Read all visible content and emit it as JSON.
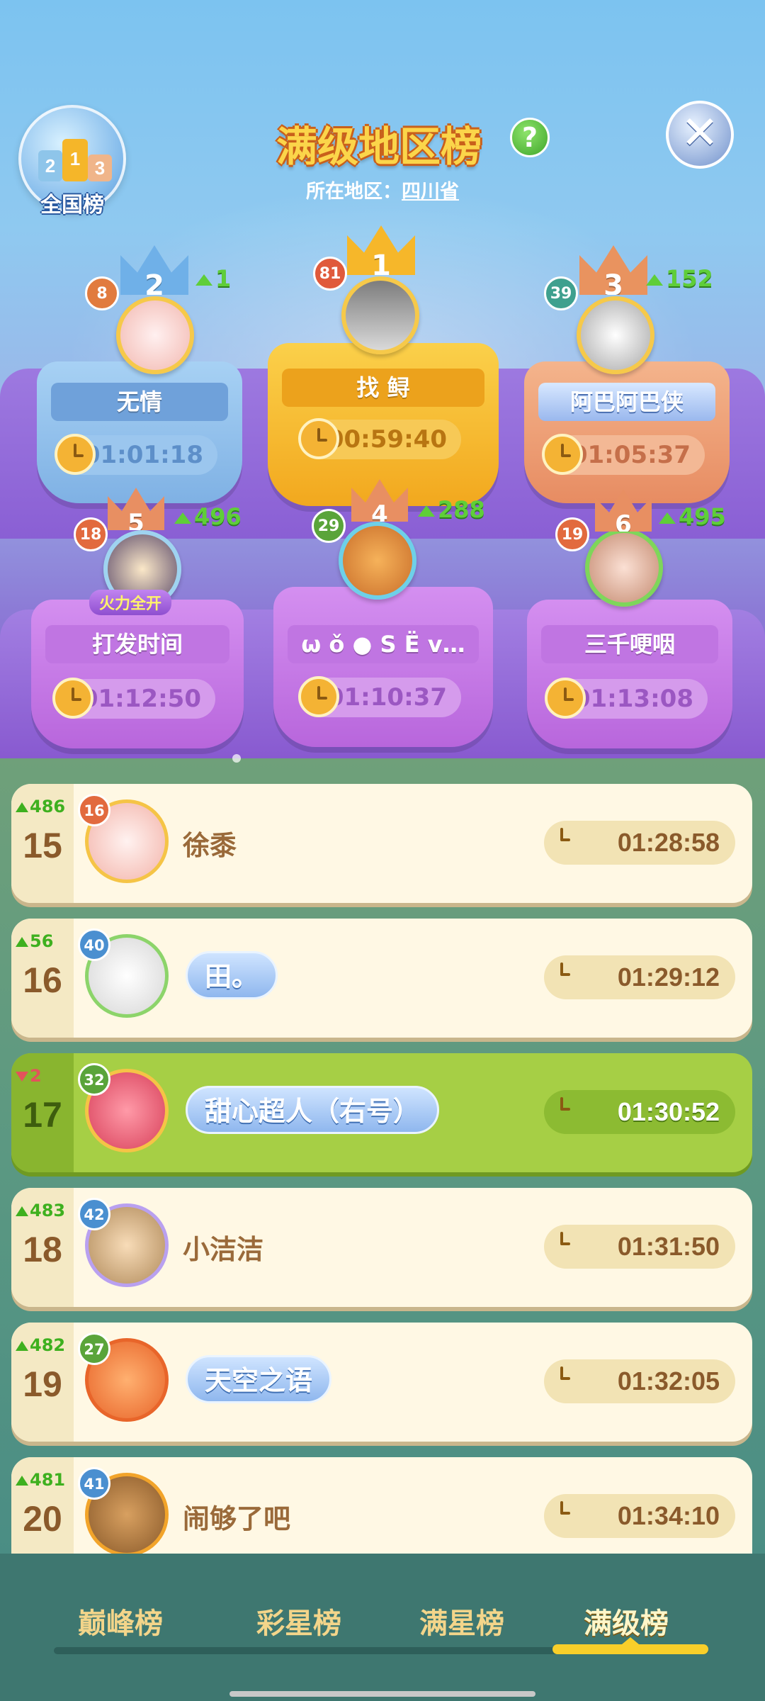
{
  "header": {
    "national_label": "全国榜",
    "national_podium": [
      "2",
      "1",
      "3"
    ],
    "title": "满级地区榜",
    "help_glyph": "?",
    "close_glyph": "✕",
    "region_label": "所在地区：",
    "region_value": "四川省"
  },
  "top6": [
    {
      "rank": "1",
      "level": "81",
      "name": "找 鲟",
      "time": "00:59:40",
      "rise": ""
    },
    {
      "rank": "2",
      "level": "8",
      "name": "无情",
      "time": "01:01:18",
      "rise": "1"
    },
    {
      "rank": "3",
      "level": "39",
      "name": "阿巴阿巴侠",
      "time": "01:05:37",
      "rise": "152"
    },
    {
      "rank": "5",
      "level": "18",
      "name": "打发时间",
      "time": "01:12:50",
      "rise": "496",
      "badge": "火力全开"
    },
    {
      "rank": "4",
      "level": "29",
      "name": "ω ǒ ● S Ë v…",
      "time": "01:10:37",
      "rise": "288"
    },
    {
      "rank": "6",
      "level": "19",
      "name": "三千哽咽",
      "time": "01:13:08",
      "rise": "495"
    }
  ],
  "list": [
    {
      "change": "486",
      "dir": "up",
      "rank": "15",
      "level": "16",
      "name": "徐黍",
      "time": "01:28:58"
    },
    {
      "change": "56",
      "dir": "up",
      "rank": "16",
      "level": "40",
      "name": "田。",
      "time": "01:29:12"
    },
    {
      "change": "2",
      "dir": "down",
      "rank": "17",
      "level": "32",
      "name": "甜心超人（右号）",
      "time": "01:30:52"
    },
    {
      "change": "483",
      "dir": "up",
      "rank": "18",
      "level": "42",
      "name": "小洁洁",
      "time": "01:31:50"
    },
    {
      "change": "482",
      "dir": "up",
      "rank": "19",
      "level": "27",
      "name": "天空之语",
      "time": "01:32:05"
    },
    {
      "change": "481",
      "dir": "up",
      "rank": "20",
      "level": "41",
      "name": "闹够了吧",
      "time": "01:34:10"
    }
  ],
  "tabs": [
    "巅峰榜",
    "彩星榜",
    "满星榜",
    "满级榜"
  ],
  "active_tab": "满级榜",
  "colors": {
    "gold": "#f6b72a",
    "silver_blue": "#8ec1ea",
    "bronze": "#f0a070",
    "purple": "#c079e6",
    "list_bg": "#fff8e4",
    "highlight": "#a6cf45"
  }
}
